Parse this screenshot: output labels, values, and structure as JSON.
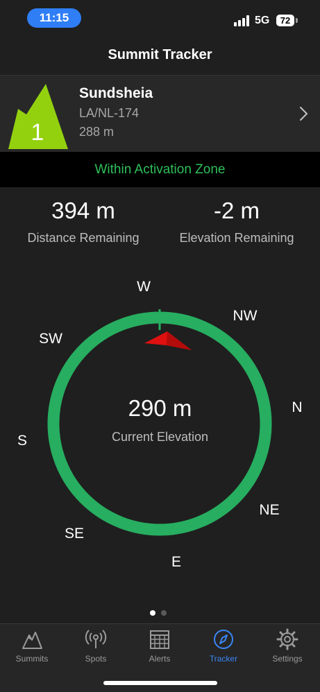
{
  "status_bar": {
    "time": "11:15",
    "network": "5G",
    "battery": "72"
  },
  "nav": {
    "title": "Summit Tracker"
  },
  "summit": {
    "rank": "1",
    "name": "Sundsheia",
    "reference": "LA/NL-174",
    "height": "288 m",
    "icon_color": "#93d10f"
  },
  "zone": {
    "status": "Within Activation Zone",
    "color": "#2fbf5a"
  },
  "stats": {
    "distance_value": "394 m",
    "distance_label": "Distance Remaining",
    "elevation_value": "-2 m",
    "elevation_label": "Elevation Remaining"
  },
  "compass": {
    "directions": {
      "w": "W",
      "nw": "NW",
      "n": "N",
      "ne": "NE",
      "e": "E",
      "se": "SE",
      "s": "S",
      "sw": "SW"
    },
    "current_value": "290 m",
    "current_label": "Current Elevation",
    "ring_color": "#27ae60",
    "pointer_color": "#e01010"
  },
  "pager": {
    "page": 1,
    "total": 2
  },
  "tabs": [
    {
      "label": "Summits",
      "icon": "mountain-icon",
      "active": false
    },
    {
      "label": "Spots",
      "icon": "broadcast-icon",
      "active": false
    },
    {
      "label": "Alerts",
      "icon": "calendar-icon",
      "active": false
    },
    {
      "label": "Tracker",
      "icon": "compass-icon",
      "active": true
    },
    {
      "label": "Settings",
      "icon": "gear-icon",
      "active": false
    }
  ]
}
